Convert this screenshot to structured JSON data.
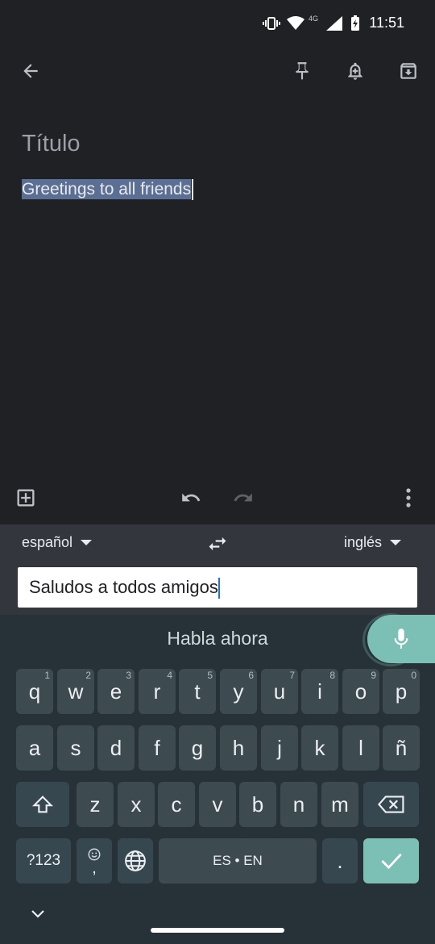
{
  "status_bar": {
    "time": "11:51",
    "network": "4G",
    "icons": [
      "vibrate-icon",
      "wifi-icon",
      "signal-icon",
      "battery-charging-icon"
    ]
  },
  "app_bar": {
    "icons": [
      "back-arrow-icon",
      "pin-icon",
      "reminder-icon",
      "archive-icon"
    ]
  },
  "note": {
    "title_placeholder": "Título",
    "body": "Greetings to all friends"
  },
  "note_toolbar": {
    "icons": [
      "add-box-icon",
      "undo-icon",
      "redo-icon",
      "more-vert-icon"
    ]
  },
  "translate": {
    "source_lang": "español",
    "target_lang": "inglés",
    "input_text": "Saludos a todos amigos"
  },
  "keyboard": {
    "voice_prompt": "Habla ahora",
    "row1": [
      {
        "k": "q",
        "h": "1"
      },
      {
        "k": "w",
        "h": "2"
      },
      {
        "k": "e",
        "h": "3"
      },
      {
        "k": "r",
        "h": "4"
      },
      {
        "k": "t",
        "h": "5"
      },
      {
        "k": "y",
        "h": "6"
      },
      {
        "k": "u",
        "h": "7"
      },
      {
        "k": "i",
        "h": "8"
      },
      {
        "k": "o",
        "h": "9"
      },
      {
        "k": "p",
        "h": "0"
      }
    ],
    "row2": [
      "a",
      "s",
      "d",
      "f",
      "g",
      "h",
      "j",
      "k",
      "l",
      "ñ"
    ],
    "row3": [
      "z",
      "x",
      "c",
      "v",
      "b",
      "n",
      "m"
    ],
    "symbols_label": "?123",
    "emoji_comma": ",",
    "space_label": "ES • EN",
    "period": ".",
    "colors": {
      "accent": "#7cc0b5",
      "key": "#3d4a50",
      "background": "#263238"
    }
  }
}
